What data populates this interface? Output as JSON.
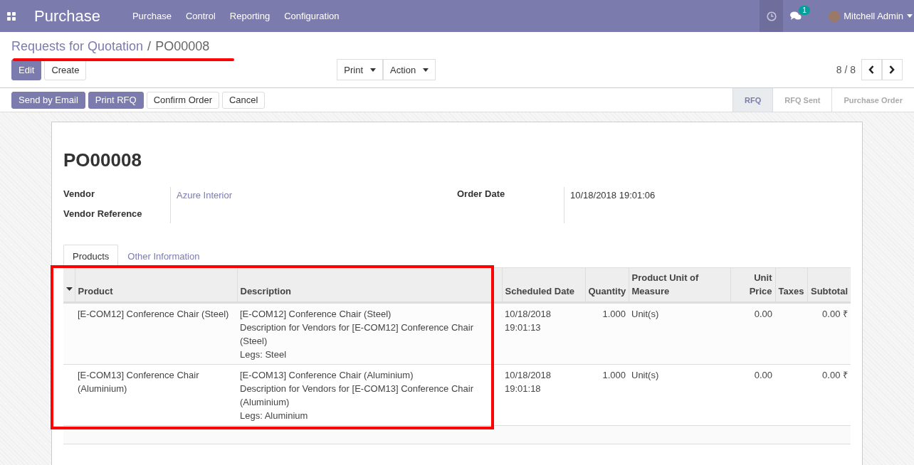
{
  "navbar": {
    "app_title": "Purchase",
    "menu": [
      "Purchase",
      "Control",
      "Reporting",
      "Configuration"
    ],
    "messages_count": "1",
    "user": "Mitchell Admin"
  },
  "breadcrumb": {
    "parent": "Requests for Quotation",
    "separator": "/",
    "current": "PO00008"
  },
  "buttons": {
    "primary": "Edit",
    "secondary": "Create"
  },
  "dropdowns": [
    "Print",
    "Action"
  ],
  "pager": "8 / 8",
  "actions": [
    {
      "label": "Send by Email",
      "kind": "primary"
    },
    {
      "label": "Print RFQ",
      "kind": "primary"
    },
    {
      "label": "Confirm Order",
      "kind": "secondary"
    },
    {
      "label": "Cancel",
      "kind": "secondary"
    }
  ],
  "status_steps": [
    {
      "label": "RFQ",
      "selected": true
    },
    {
      "label": "RFQ Sent",
      "selected": false
    },
    {
      "label": "Purchase Order",
      "selected": false
    }
  ],
  "sheet": {
    "title": "PO00008",
    "left_fields": [
      {
        "label": "Vendor",
        "value": "Azure Interior"
      },
      {
        "label": "Vendor Reference"
      }
    ],
    "right_fields": [
      {
        "label": "Order Date",
        "value": "10/18/2018 19:01:06"
      }
    ]
  },
  "tabs": [
    {
      "label": "Products",
      "selected": true
    },
    {
      "label": "Other Information",
      "selected": false
    }
  ],
  "table": {
    "columns": [
      {
        "label": "Product",
        "kind": "text"
      },
      {
        "label": "Description",
        "kind": "text"
      },
      {
        "label": "Scheduled Date",
        "kind": "text"
      },
      {
        "label": "Quantity",
        "kind": "number"
      },
      {
        "label": "Product Unit of Measure",
        "kind": "text"
      },
      {
        "label": "Unit Price",
        "kind": "number"
      },
      {
        "label": "Taxes",
        "kind": "text"
      },
      {
        "label": "Subtotal",
        "kind": "number"
      }
    ],
    "rows": [
      {
        "cells": [
          [
            "[E-COM12] Conference Chair (Steel)"
          ],
          [
            "[E-COM12] Conference Chair (Steel)",
            "Description for Vendors for [E-COM12] Conference Chair (Steel)",
            "Legs: Steel"
          ],
          [
            "10/18/2018 19:01:13"
          ],
          [
            "1.000"
          ],
          [
            "Unit(s)"
          ],
          [
            "0.00"
          ],
          [],
          [
            "0.00 ₹"
          ]
        ]
      },
      {
        "cells": [
          [
            "[E-COM13] Conference Chair (Aluminium)"
          ],
          [
            "[E-COM13] Conference Chair (Aluminium)",
            "Description for Vendors for [E-COM13] Conference Chair (Aluminium)",
            "Legs: Aluminium"
          ],
          [
            "10/18/2018 19:01:18"
          ],
          [
            "1.000"
          ],
          [
            "Unit(s)"
          ],
          [
            "0.00"
          ],
          [],
          [
            "0.00 ₹"
          ]
        ]
      }
    ]
  }
}
